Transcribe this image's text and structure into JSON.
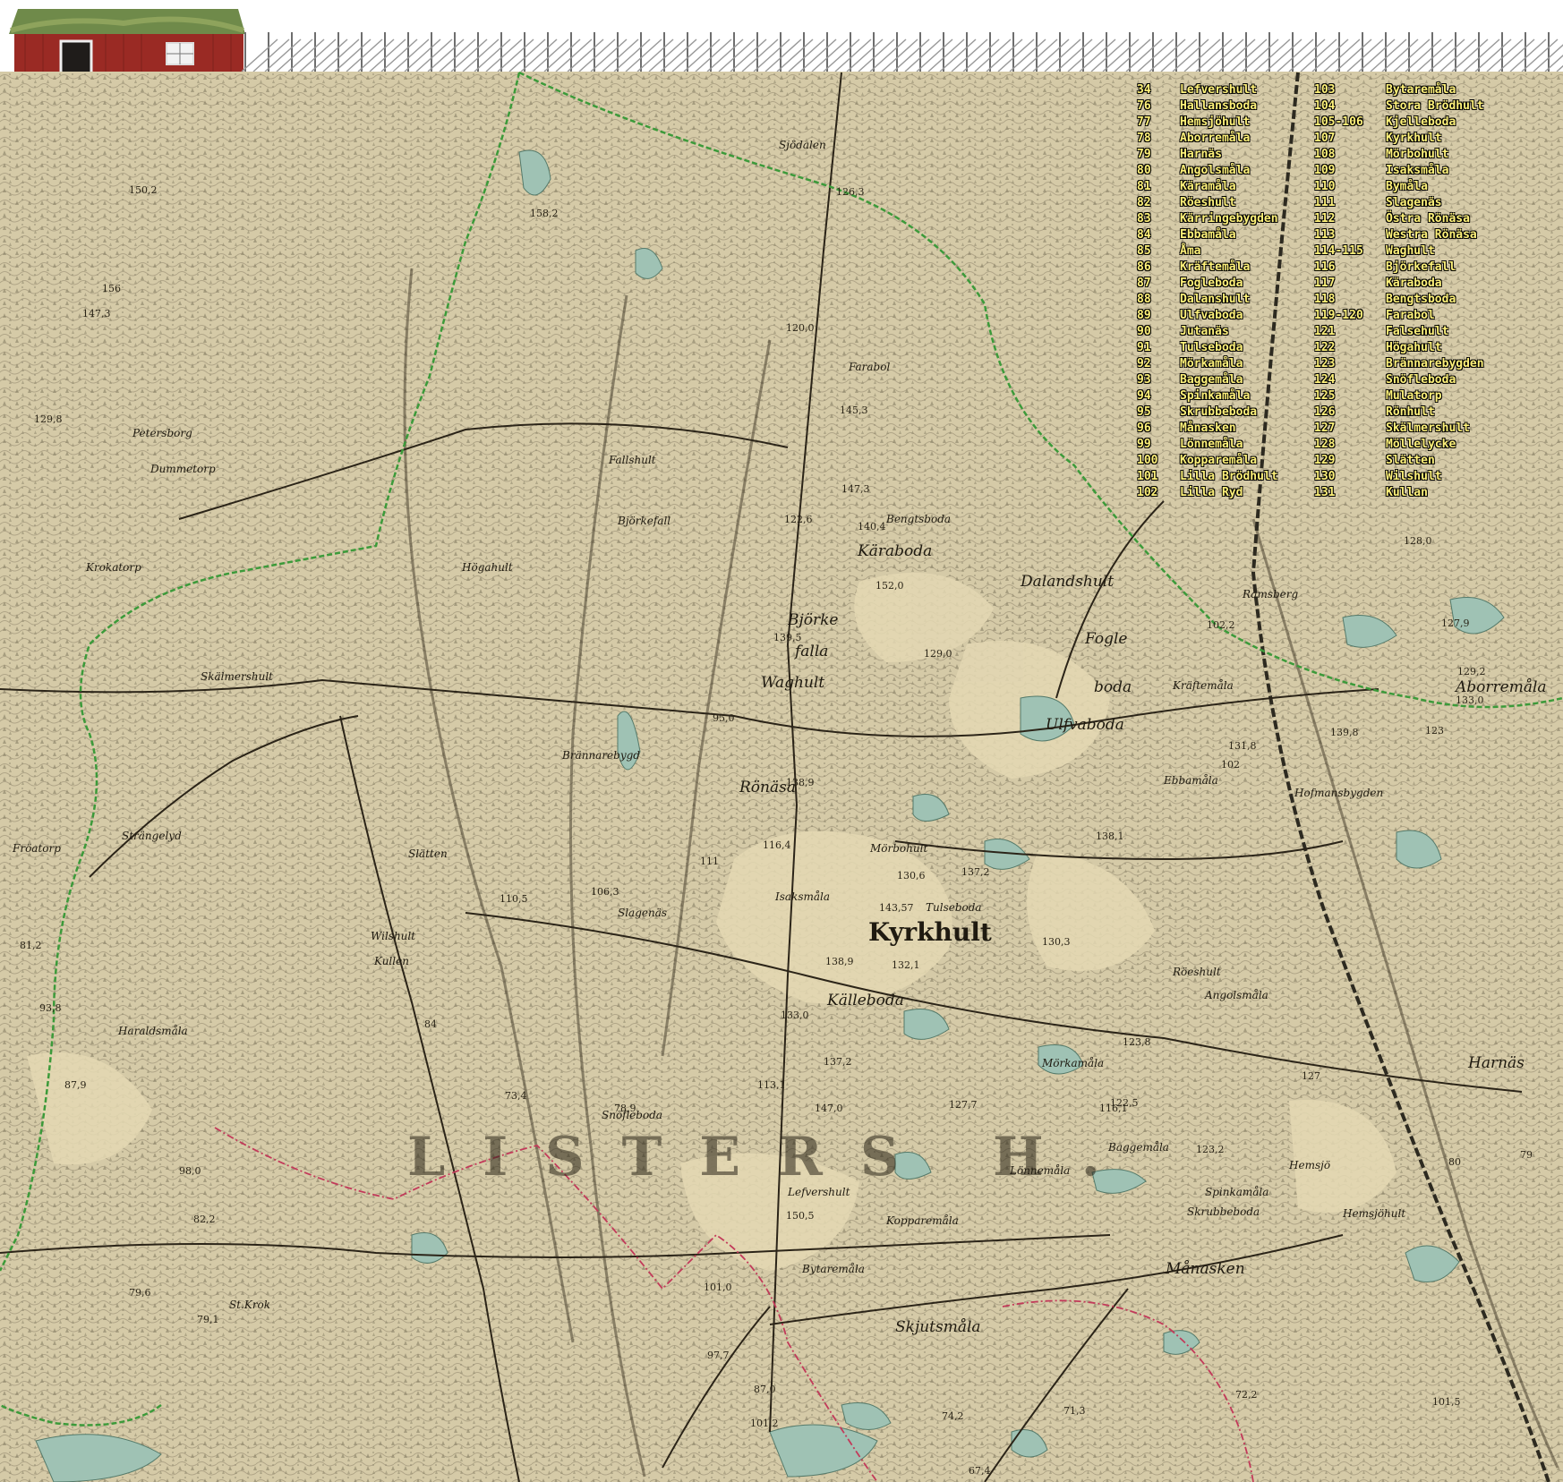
{
  "legend": [
    {
      "num": "34",
      "name": "Lefvershult",
      "num2": "103",
      "name2": "Bytaremåla"
    },
    {
      "num": "76",
      "name": "Hallansboda",
      "num2": "104",
      "name2": "Stora Brödhult"
    },
    {
      "num": "77",
      "name": "Hemsjöhult",
      "num2": "105-106",
      "name2": "Kjelleboda"
    },
    {
      "num": "78",
      "name": "Aborremåla",
      "num2": "107",
      "name2": "Kyrkhult"
    },
    {
      "num": "79",
      "name": "Harnäs",
      "num2": "108",
      "name2": "Mörbohult"
    },
    {
      "num": "80",
      "name": "Angolsmåla",
      "num2": "109",
      "name2": "Isaksmåla"
    },
    {
      "num": "81",
      "name": "Käramåla",
      "num2": "110",
      "name2": "Bymåla"
    },
    {
      "num": "82",
      "name": "Röeshult",
      "num2": "111",
      "name2": "Slagenäs"
    },
    {
      "num": "83",
      "name": "Kärringebygden",
      "num2": "112",
      "name2": "Östra Rönäsa"
    },
    {
      "num": "84",
      "name": "Ebbamåla",
      "num2": "113",
      "name2": "Westra Rönäsa"
    },
    {
      "num": "85",
      "name": "Åma",
      "num2": "114-115",
      "name2": "Waghult"
    },
    {
      "num": "86",
      "name": "Kräftemåla",
      "num2": "116",
      "name2": "Björkefall"
    },
    {
      "num": "87",
      "name": "Fogleboda",
      "num2": "117",
      "name2": "Käraboda"
    },
    {
      "num": "88",
      "name": "Dalanshult",
      "num2": "118",
      "name2": "Bengtsboda"
    },
    {
      "num": "89",
      "name": "Ulfvaboda",
      "num2": "119-120",
      "name2": "Farabol"
    },
    {
      "num": "90",
      "name": "Jutanäs",
      "num2": "121",
      "name2": "Falsehult"
    },
    {
      "num": "91",
      "name": "Tulseboda",
      "num2": "122",
      "name2": "Högahult"
    },
    {
      "num": "92",
      "name": "Mörkamåla",
      "num2": "123",
      "name2": "Brännarebygden"
    },
    {
      "num": "93",
      "name": "Baggemåla",
      "num2": "124",
      "name2": "Snöfleboda"
    },
    {
      "num": "94",
      "name": "Spinkamåla",
      "num2": "125",
      "name2": "Mulatorp"
    },
    {
      "num": "95",
      "name": "Skrubbeboda",
      "num2": "126",
      "name2": "Rönhult"
    },
    {
      "num": "96",
      "name": "Månasken",
      "num2": "127",
      "name2": "Skälmershult"
    },
    {
      "num": "99",
      "name": "Lönnemåla",
      "num2": "128",
      "name2": "Möllelycke"
    },
    {
      "num": "100",
      "name": "Kopparemåla",
      "num2": "129",
      "name2": "Slätten"
    },
    {
      "num": "101",
      "name": "Lilla Brödhult",
      "num2": "130",
      "name2": "Wilshult"
    },
    {
      "num": "102",
      "name": "Lilla Ryd",
      "num2": "131",
      "name2": "Kullan"
    }
  ],
  "district_label": "LISTERS H.",
  "places": {
    "kyrkhult": "Kyrkhult",
    "karaboda": "Käraboda",
    "dalandshult": "Dalandshult",
    "bjorke": "Björke",
    "falla": "falla",
    "waghult": "Waghult",
    "fogle": "Fogle",
    "boda": "boda",
    "ulfvaboda": "Ulfvaboda",
    "ronasa": "Rönäsa",
    "kalleboda": "Källeboda",
    "farabol": "Farabol",
    "ramsberg": "Ramsberg",
    "hofmansbygd": "Hofmansbygden",
    "harnas": "Harnäs",
    "manasken": "Månasken",
    "skjutsmala": "Skjutsmåla",
    "wilshult": "Wilshult",
    "kullen": "Kullen",
    "slatten": "Slätten",
    "strangelyd": "Strängelyd",
    "froatorp": "Fröatorp",
    "skalmershult": "Skälmershult",
    "brannarebygd": "Brännarebygd",
    "hogahult": "Högahult",
    "hemsjo": "Hemsjö",
    "lefvershult": "Lefvershult",
    "kopparemala": "Kopparemåla",
    "baggemala": "Baggemåla",
    "morkamala": "Mörkamåla",
    "spinkamala": "Spinkamåla",
    "skrubbeboda": "Skrubbeboda",
    "isaksmala": "Isaksmåla",
    "morbohult": "Mörbohult",
    "tulseboda": "Tulseboda",
    "snofleboda": "Snöfleboda",
    "angolsmala": "Angolsmåla",
    "roeshult": "Röeshult",
    "ebbamala": "Ebbamåla",
    "krottemala": "Kräftemåla",
    "aborremala": "Aborremåla",
    "dummetorp": "Dummetorp",
    "petersborg": "Petersborg",
    "krokatorp": "Krokatorp",
    "bengtsboda": "Bengtsboda",
    "fallshult": "Fallshult",
    "bjorkefall": "Björkefall",
    "bytaremala": "Bytaremåla",
    "lonnemala": "Lönnemåla",
    "haraldsmala": "Haraldsmåla",
    "hemsjohult": "Hemsjöhult",
    "sjodalen": "Sjödalen",
    "slagenas": "Slagenäs",
    "stkrok": "St.Krok"
  },
  "elevations": [
    "126,3",
    "120,0",
    "145,3",
    "147,3",
    "122,6",
    "140,4",
    "152,0",
    "139,5",
    "129,0",
    "95,0",
    "138,9",
    "116,4",
    "130,6",
    "137,2",
    "110,5",
    "106,3",
    "111",
    "143,57",
    "138,9",
    "132,1",
    "130,3",
    "133,0",
    "123,8",
    "137,2",
    "138,1",
    "131,8",
    "139,8",
    "102",
    "129,2",
    "123",
    "133,0",
    "127,7",
    "113,1",
    "147,0",
    "122,5",
    "116,1",
    "127",
    "123,2",
    "150,5",
    "101,0",
    "97,7",
    "87,0",
    "101,2",
    "74,2",
    "71,3",
    "67,4",
    "72,2",
    "101,5",
    "98,0",
    "82,2",
    "79,1",
    "87,9",
    "93,8",
    "81,2",
    "129,8",
    "150,2",
    "156",
    "158,2",
    "147,3",
    "102,2",
    "128,0",
    "127,9",
    "79",
    "80",
    "84",
    "73,4",
    "78,9",
    "79,6"
  ],
  "colors": {
    "paper": "#d9cfae",
    "forest": "#b9ae8a",
    "lake": "#9fc2b4",
    "road": "#2b2418",
    "parish_border": "#3c9a3a",
    "district_border": "#c23a5a",
    "legend_text": "#fff27a",
    "cabin_red": "#9a2a24",
    "roof_green": "#6f8a4a"
  }
}
